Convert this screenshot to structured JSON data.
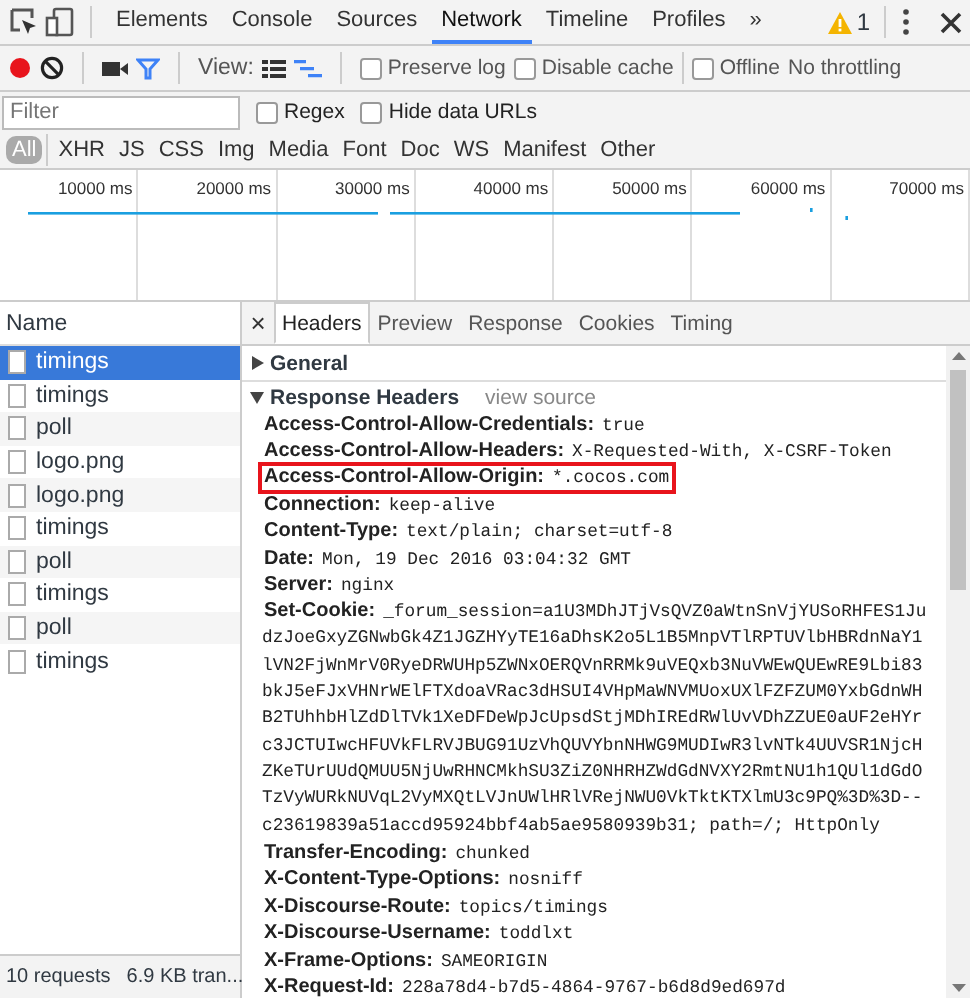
{
  "main_tabs": [
    {
      "label": "Elements",
      "selected": false
    },
    {
      "label": "Console",
      "selected": false
    },
    {
      "label": "Sources",
      "selected": false
    },
    {
      "label": "Network",
      "selected": true
    },
    {
      "label": "Timeline",
      "selected": false
    },
    {
      "label": "Profiles",
      "selected": false
    }
  ],
  "overflow": "»",
  "warning_count": "1",
  "toolbar": {
    "recording": true,
    "view_label": "View:",
    "options": [
      {
        "label": "Preserve log",
        "checked": false
      },
      {
        "label": "Disable cache",
        "checked": false
      },
      {
        "label": "Offline",
        "checked": false
      }
    ],
    "throttling": "No throttling"
  },
  "filter": {
    "placeholder": "Filter",
    "options": [
      {
        "label": "Regex",
        "checked": false
      },
      {
        "label": "Hide data URLs",
        "checked": false
      }
    ]
  },
  "types": [
    {
      "label": "All",
      "selected": true
    },
    {
      "label": "XHR",
      "selected": false
    },
    {
      "label": "JS",
      "selected": false
    },
    {
      "label": "CSS",
      "selected": false
    },
    {
      "label": "Img",
      "selected": false
    },
    {
      "label": "Media",
      "selected": false
    },
    {
      "label": "Font",
      "selected": false
    },
    {
      "label": "Doc",
      "selected": false
    },
    {
      "label": "WS",
      "selected": false
    },
    {
      "label": "Manifest",
      "selected": false
    },
    {
      "label": "Other",
      "selected": false
    }
  ],
  "timeline_ticks": [
    "10000 ms",
    "20000 ms",
    "30000 ms",
    "40000 ms",
    "50000 ms",
    "60000 ms",
    "70000 ms"
  ],
  "requests": {
    "column": "Name",
    "items": [
      {
        "name": "timings",
        "selected": true
      },
      {
        "name": "timings",
        "selected": false
      },
      {
        "name": "poll",
        "selected": false
      },
      {
        "name": "logo.png",
        "selected": false
      },
      {
        "name": "logo.png",
        "selected": false
      },
      {
        "name": "timings",
        "selected": false
      },
      {
        "name": "poll",
        "selected": false
      },
      {
        "name": "timings",
        "selected": false
      },
      {
        "name": "poll",
        "selected": false
      },
      {
        "name": "timings",
        "selected": false
      }
    ]
  },
  "status_bar": [
    "10 requests",
    "6.9 KB tran..."
  ],
  "detail_tabs": {
    "close": "×",
    "tabs": [
      {
        "label": "Headers",
        "selected": true
      },
      {
        "label": "Preview",
        "selected": false
      },
      {
        "label": "Response",
        "selected": false
      },
      {
        "label": "Cookies",
        "selected": false
      },
      {
        "label": "Timing",
        "selected": false
      }
    ]
  },
  "sections": [
    {
      "title": "General",
      "expanded": false
    },
    {
      "title": "Response Headers",
      "expanded": true,
      "link": "view source"
    }
  ],
  "response_headers": [
    {
      "name": "Access-Control-Allow-Credentials:",
      "value": [
        "true"
      ],
      "highlighted": false
    },
    {
      "name": "Access-Control-Allow-Headers:",
      "value": [
        "X-Requested-With, X-CSRF-Token"
      ],
      "highlighted": false
    },
    {
      "name": "Access-Control-Allow-Origin:",
      "value": [
        "*.cocos.com"
      ],
      "highlighted": true
    },
    {
      "name": "Connection:",
      "value": [
        "keep-alive"
      ],
      "highlighted": false
    },
    {
      "name": "Content-Type:",
      "value": [
        "text/plain; charset=utf-8"
      ],
      "highlighted": false
    },
    {
      "name": "Date:",
      "value": [
        "Mon, 19 Dec 2016 03:04:32 GMT"
      ],
      "highlighted": false
    },
    {
      "name": "Server:",
      "value": [
        "nginx"
      ],
      "highlighted": false
    },
    {
      "name": "Set-Cookie:",
      "value": [
        "_forum_session=a1U3MDhJTjVsQVZ0aWtnSnVjYUSoRHFES1Ju",
        "dzJoeGxyZGNwbGk4Z1JGZHYyTE16aDhsK2o5L1B5MnpVTlRPTUVlbHBRdnNaY1",
        "lVN2FjWnMrV0RyeDRWUHp5ZWNxOERQVnRRMk9uVEQxb3NuVWEwQUEwRE9Lbi83",
        "bkJ5eFJxVHNrWElFTXdoaVRac3dHSUI4VHpMaWNVMUoxUXlFZFZUM0YxbGdnWH",
        "B2TUhhbHlZdDlTVk1XeDFDeWpJcUpsdStjMDhIREdRWlUvVDhZZUE0aUF2eHYr",
        "c3JCTUIwcHFUVkFLRVJBUG91UzVhQUVYbnNHWG9MUDIwR3lvNTk4UUVSR1NjcH",
        "ZKeTUrUUdQMUU5NjUwRHNCMkhSU3ZiZ0NHRHZWdGdNVXY2RmtNU1h1QUl1dGdO",
        "TzVyWURkNUVqL2VyMXQtLVJnUWlHRlVRejNWU0VkTktKTXlmU3c9PQ%3D%3D--",
        "c23619839a51accd95924bbf4ab5ae9580939b31; path=/; HttpOnly"
      ],
      "highlighted": false
    },
    {
      "name": "Transfer-Encoding:",
      "value": [
        "chunked"
      ],
      "highlighted": false
    },
    {
      "name": "X-Content-Type-Options:",
      "value": [
        "nosniff"
      ],
      "highlighted": false
    },
    {
      "name": "X-Discourse-Route:",
      "value": [
        "topics/timings"
      ],
      "highlighted": false
    },
    {
      "name": "X-Discourse-Username:",
      "value": [
        "toddlxt"
      ],
      "highlighted": false
    },
    {
      "name": "X-Frame-Options:",
      "value": [
        "SAMEORIGIN"
      ],
      "highlighted": false
    },
    {
      "name": "X-Request-Id:",
      "value": [
        "228a78d4-b7d5-4864-9767-b6d8d9ed697d"
      ],
      "highlighted": false
    }
  ]
}
